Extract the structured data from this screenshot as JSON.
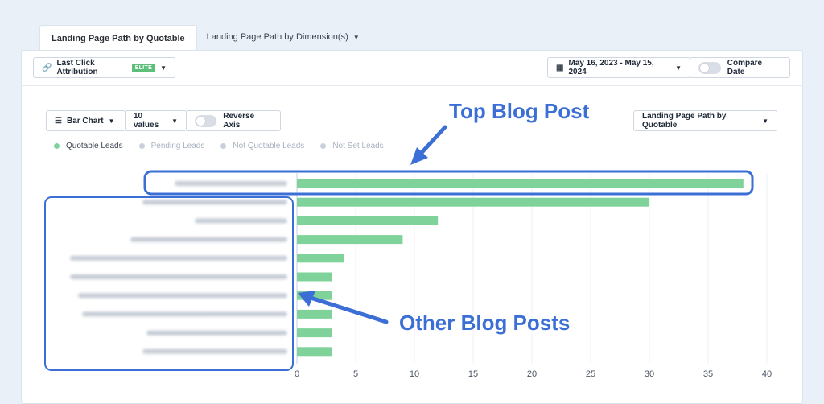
{
  "tabs": [
    {
      "label": "Landing Page Path by Quotable"
    },
    {
      "label": "Landing Page Path by Dimension(s)"
    }
  ],
  "toolbar": {
    "attribution_label": "Last Click Attribution",
    "attribution_badge": "ELITE",
    "date_range": "May 16, 2023 - May 15, 2024",
    "compare_label": "Compare Date"
  },
  "chart_controls": {
    "chart_type": "Bar Chart",
    "values_count": "10 values",
    "reverse_axis": "Reverse Axis",
    "dimension_select": "Landing Page Path by Quotable"
  },
  "legend": [
    {
      "label": "Quotable Leads",
      "color": "#7fd39a",
      "active": true
    },
    {
      "label": "Pending Leads",
      "color": "#c9cfdb",
      "active": false
    },
    {
      "label": "Not Quotable Leads",
      "color": "#c9cfdb",
      "active": false
    },
    {
      "label": "Not Set Leads",
      "color": "#c9cfdb",
      "active": false
    }
  ],
  "annotations": {
    "top": "Top Blog Post",
    "other": "Other Blog Posts"
  },
  "chart_data": {
    "type": "bar",
    "orientation": "horizontal",
    "categories": [
      "",
      "",
      "",
      "",
      "",
      "",
      "",
      "",
      "",
      ""
    ],
    "series": [
      {
        "name": "Quotable Leads",
        "values": [
          38,
          30,
          12,
          9,
          4,
          3,
          3,
          3,
          3,
          3
        ]
      }
    ],
    "xlim": [
      0,
      40
    ],
    "xticks": [
      0,
      5,
      10,
      15,
      20,
      25,
      30,
      35,
      40
    ],
    "grid": true,
    "bar_color": "#7fd39a"
  }
}
